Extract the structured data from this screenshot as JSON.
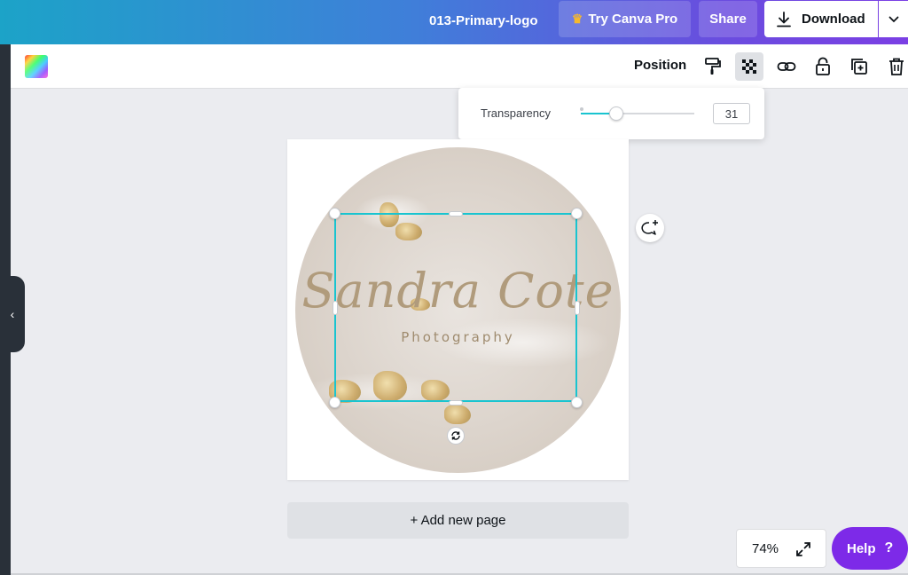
{
  "topbar": {
    "doc_title": "013-Primary-logo",
    "try_pro_label": "Try Canva Pro",
    "share_label": "Share",
    "download_label": "Download"
  },
  "toolbar": {
    "position_label": "Position",
    "icons": [
      "paint-roller-icon",
      "transparency-icon",
      "link-icon",
      "lock-icon",
      "duplicate-icon",
      "trash-icon"
    ]
  },
  "transparency": {
    "label": "Transparency",
    "value": "31",
    "level": 0.31
  },
  "canvas": {
    "logo_title": "Sandra Cote",
    "logo_subtitle": "Photography"
  },
  "add_page_label": "+ Add new page",
  "zoom": {
    "value": "74%"
  },
  "help": {
    "label": "Help",
    "icon_text": "?"
  },
  "colors": {
    "accent": "#19c4d0",
    "help_purple": "#7d2ae8",
    "logo_text": "#b09b7c"
  }
}
